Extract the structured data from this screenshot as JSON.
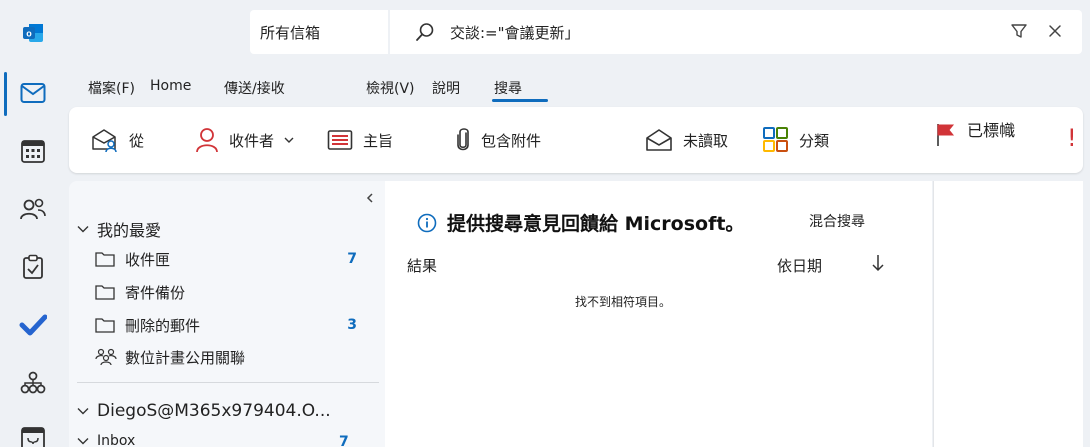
{
  "app": {
    "logo_letter": "o",
    "accent": "#0f6cbd"
  },
  "rail": {
    "items": [
      {
        "name": "outlook-logo-icon"
      },
      {
        "name": "mail-icon"
      },
      {
        "name": "calendar-icon"
      },
      {
        "name": "people-icon"
      },
      {
        "name": "tasks-icon"
      },
      {
        "name": "todo-icon"
      },
      {
        "name": "org-icon"
      },
      {
        "name": "bookings-icon"
      }
    ]
  },
  "search": {
    "scope": "所有信箱",
    "query": "交談:=\"會議更新」"
  },
  "menu": {
    "tabs": [
      "檔案(F)",
      "Home",
      "傳送/接收",
      "檢視(V)",
      "說明",
      "搜尋"
    ],
    "active": "搜尋"
  },
  "ribbon": {
    "from": "從",
    "to": "收件者",
    "subject": "主旨",
    "attachments": "包含附件",
    "unread": "未讀取",
    "categorize": "分類",
    "flagged": "已標幟",
    "important": "!"
  },
  "folders": {
    "favorites_label": "我的最愛",
    "items": [
      {
        "label": "收件匣",
        "count": "7"
      },
      {
        "label": "寄件備份",
        "count": ""
      },
      {
        "label": "刪除的郵件",
        "count": "3"
      },
      {
        "label": "數位計畫公用關聯",
        "count": ""
      }
    ],
    "account_label": "DiegoS@M365x979404.O...",
    "account_items": [
      {
        "label": "Inbox",
        "count": "7"
      }
    ]
  },
  "list": {
    "feedback": "提供搜尋意見回饋給 Microsoft。",
    "mixed_search": "混合搜尋",
    "results": "結果",
    "sort_by": "依日期",
    "empty": "找不到相符項目。"
  }
}
